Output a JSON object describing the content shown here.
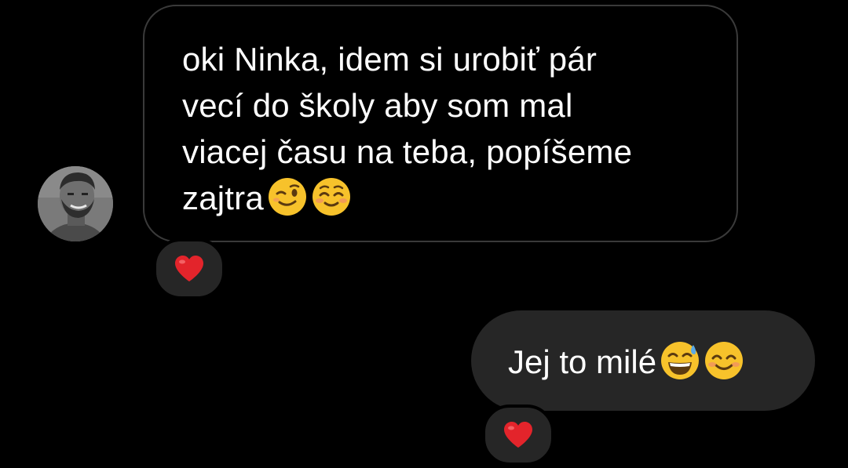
{
  "conversation": {
    "incoming": {
      "text": "oki Ninka, idem si urobiť pár\nvecí do školy aby som mal\nviacej času na teba, popíšeme\nzajtra",
      "emojis": [
        "winking-face",
        "smiling-face-relaxed"
      ],
      "reaction": "red-heart",
      "avatar": "user-avatar-photo"
    },
    "outgoing": {
      "text": "Jej to milé",
      "emojis": [
        "grinning-face-with-sweat",
        "smiling-face-with-smiling-eyes"
      ],
      "reaction": "red-heart"
    }
  },
  "colors": {
    "background": "#000000",
    "incoming_border": "#3a3a3a",
    "outgoing_bubble": "#262626",
    "reaction_bg": "#262626",
    "text": "#ffffff",
    "heart": "#e3242b",
    "emoji_yellow": "#f7c22b"
  }
}
